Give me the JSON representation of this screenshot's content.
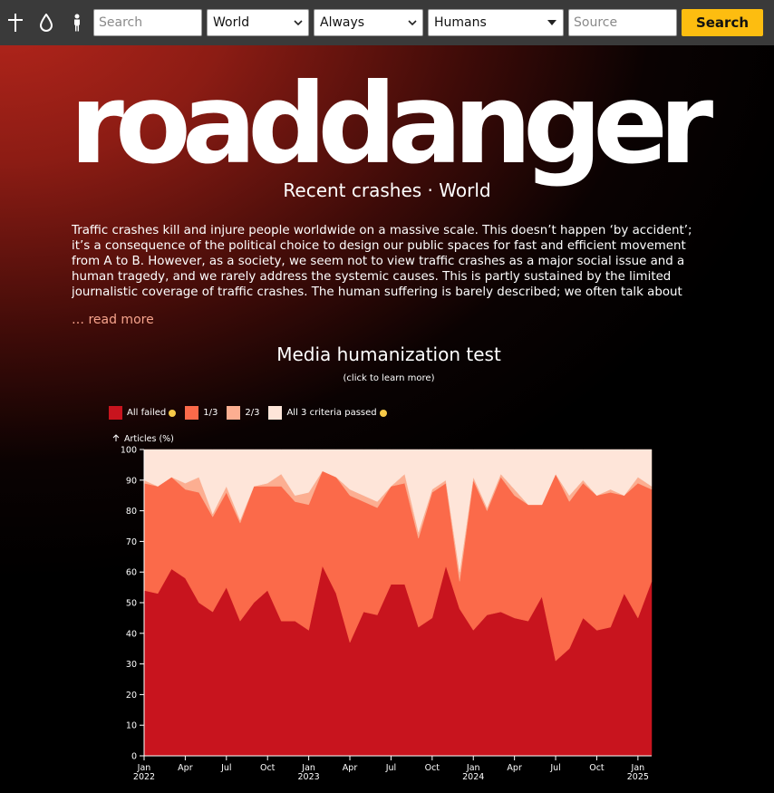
{
  "topbar": {
    "search_placeholder": "Search",
    "region_value": "World",
    "period_value": "Always",
    "subject_value": "Humans",
    "source_placeholder": "Source",
    "search_button": "Search",
    "icons": [
      "cross-icon",
      "drop-icon",
      "person-icon"
    ]
  },
  "header": {
    "logo": "roaddanger",
    "subtitle": "Recent crashes · World"
  },
  "intro": {
    "text": "Traffic crashes kill and injure people worldwide on a massive scale. This doesn’t happen ‘by accident’; it’s a consequence of the political choice to design our public spaces for fast and efficient movement from A to B. However, as a society, we seem not to view traffic crashes as a major social issue and a human tragedy, and we rarely address the systemic causes. This is partly sustained by the limited journalistic coverage of traffic crashes. The human suffering is barely described; we often talk about vehicles rather…",
    "read_more": "… read more"
  },
  "chart_section": {
    "title": "Media humanization test",
    "subtitle": "(click to learn more)"
  },
  "chart_data": {
    "type": "area",
    "stacked": true,
    "ylabel": "Articles (%)",
    "ylim": [
      0,
      100
    ],
    "yticks": [
      0,
      10,
      20,
      30,
      40,
      50,
      60,
      70,
      80,
      90,
      100
    ],
    "xrange": [
      "2022-01",
      "2025-02"
    ],
    "xticks": [
      {
        "month": 0,
        "label": "Jan",
        "year": "2022"
      },
      {
        "month": 3,
        "label": "Apr",
        "year": ""
      },
      {
        "month": 6,
        "label": "Jul",
        "year": ""
      },
      {
        "month": 9,
        "label": "Oct",
        "year": ""
      },
      {
        "month": 12,
        "label": "Jan",
        "year": "2023"
      },
      {
        "month": 15,
        "label": "Apr",
        "year": ""
      },
      {
        "month": 18,
        "label": "Jul",
        "year": ""
      },
      {
        "month": 21,
        "label": "Oct",
        "year": ""
      },
      {
        "month": 24,
        "label": "Jan",
        "year": "2024"
      },
      {
        "month": 27,
        "label": "Apr",
        "year": ""
      },
      {
        "month": 30,
        "label": "Jul",
        "year": ""
      },
      {
        "month": 33,
        "label": "Oct",
        "year": ""
      },
      {
        "month": 36,
        "label": "Jan",
        "year": "2025"
      }
    ],
    "x": [
      0,
      1,
      2,
      3,
      4,
      5,
      6,
      7,
      8,
      9,
      10,
      11,
      12,
      13,
      14,
      15,
      16,
      17,
      18,
      19,
      20,
      21,
      22,
      23,
      24,
      25,
      26,
      27,
      28,
      29,
      30,
      31,
      32,
      33,
      34,
      35,
      36,
      37
    ],
    "series": [
      {
        "name": "All failed",
        "color": "#c8141e",
        "values": [
          54,
          53,
          61,
          58,
          50,
          47,
          55,
          44,
          50,
          54,
          44,
          44,
          41,
          62,
          53,
          37,
          47,
          46,
          56,
          56,
          42,
          45,
          62,
          48,
          41,
          46,
          47,
          45,
          44,
          52,
          31,
          35,
          45,
          41,
          42,
          53,
          45,
          57
        ]
      },
      {
        "name": "1/3",
        "color": "#fb6a4a",
        "values": [
          35,
          35,
          30,
          29,
          36,
          31,
          31,
          32,
          38,
          34,
          44,
          39,
          41,
          31,
          38,
          48,
          36,
          35,
          32,
          33,
          29,
          41,
          27,
          9,
          49,
          34,
          44,
          40,
          38,
          30,
          61,
          48,
          44,
          44,
          44,
          32,
          44,
          30
        ]
      },
      {
        "name": "2/3",
        "color": "#fcae91",
        "values": [
          1,
          0,
          0,
          2,
          5,
          1,
          2,
          1,
          0,
          1,
          4,
          2,
          4,
          0,
          0,
          2,
          2,
          2,
          0,
          3,
          2,
          1,
          1,
          3,
          1,
          1,
          1,
          2,
          0,
          0,
          0,
          2,
          1,
          0,
          1,
          0,
          2,
          1
        ]
      },
      {
        "name": "All 3 criteria passed",
        "color": "#fee5d9",
        "values": [
          10,
          12,
          9,
          11,
          9,
          21,
          12,
          23,
          12,
          11,
          8,
          15,
          14,
          7,
          9,
          13,
          15,
          17,
          12,
          8,
          27,
          13,
          10,
          40,
          9,
          19,
          8,
          13,
          18,
          18,
          8,
          15,
          10,
          15,
          13,
          15,
          9,
          12
        ]
      }
    ],
    "colors": {
      "accent": "#fdbd10",
      "link": "#f6a38c",
      "topbar": "#3a3a3a"
    }
  }
}
